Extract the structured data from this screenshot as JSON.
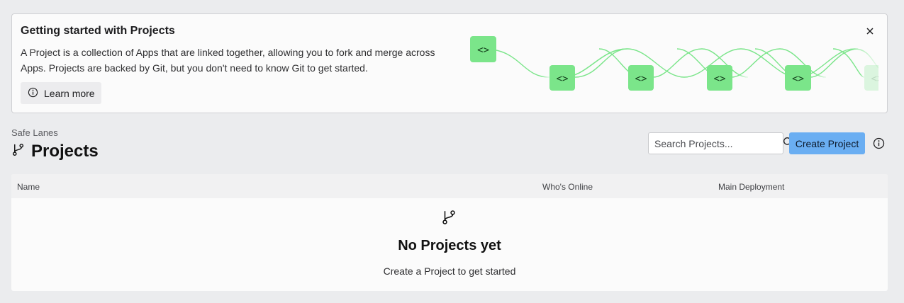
{
  "banner": {
    "title": "Getting started with Projects",
    "description": "A Project is a collection of Apps that are linked together, allowing you to fork and merge across Apps. Projects are backed by Git, but you don't need to know Git to get started.",
    "learn_more_label": "Learn more",
    "close_icon": "close-icon",
    "illustration_color": "#7be58a"
  },
  "header": {
    "workspace": "Safe Lanes",
    "title": "Projects",
    "title_icon": "git-branch-icon"
  },
  "search": {
    "placeholder": "Search Projects..."
  },
  "actions": {
    "create_label": "Create Project",
    "accent": "#6aaef2"
  },
  "table": {
    "columns": [
      "Name",
      "Who's Online",
      "Main Deployment"
    ]
  },
  "empty_state": {
    "icon": "git-branch-icon",
    "title": "No Projects yet",
    "text": "Create a Project to get started"
  }
}
